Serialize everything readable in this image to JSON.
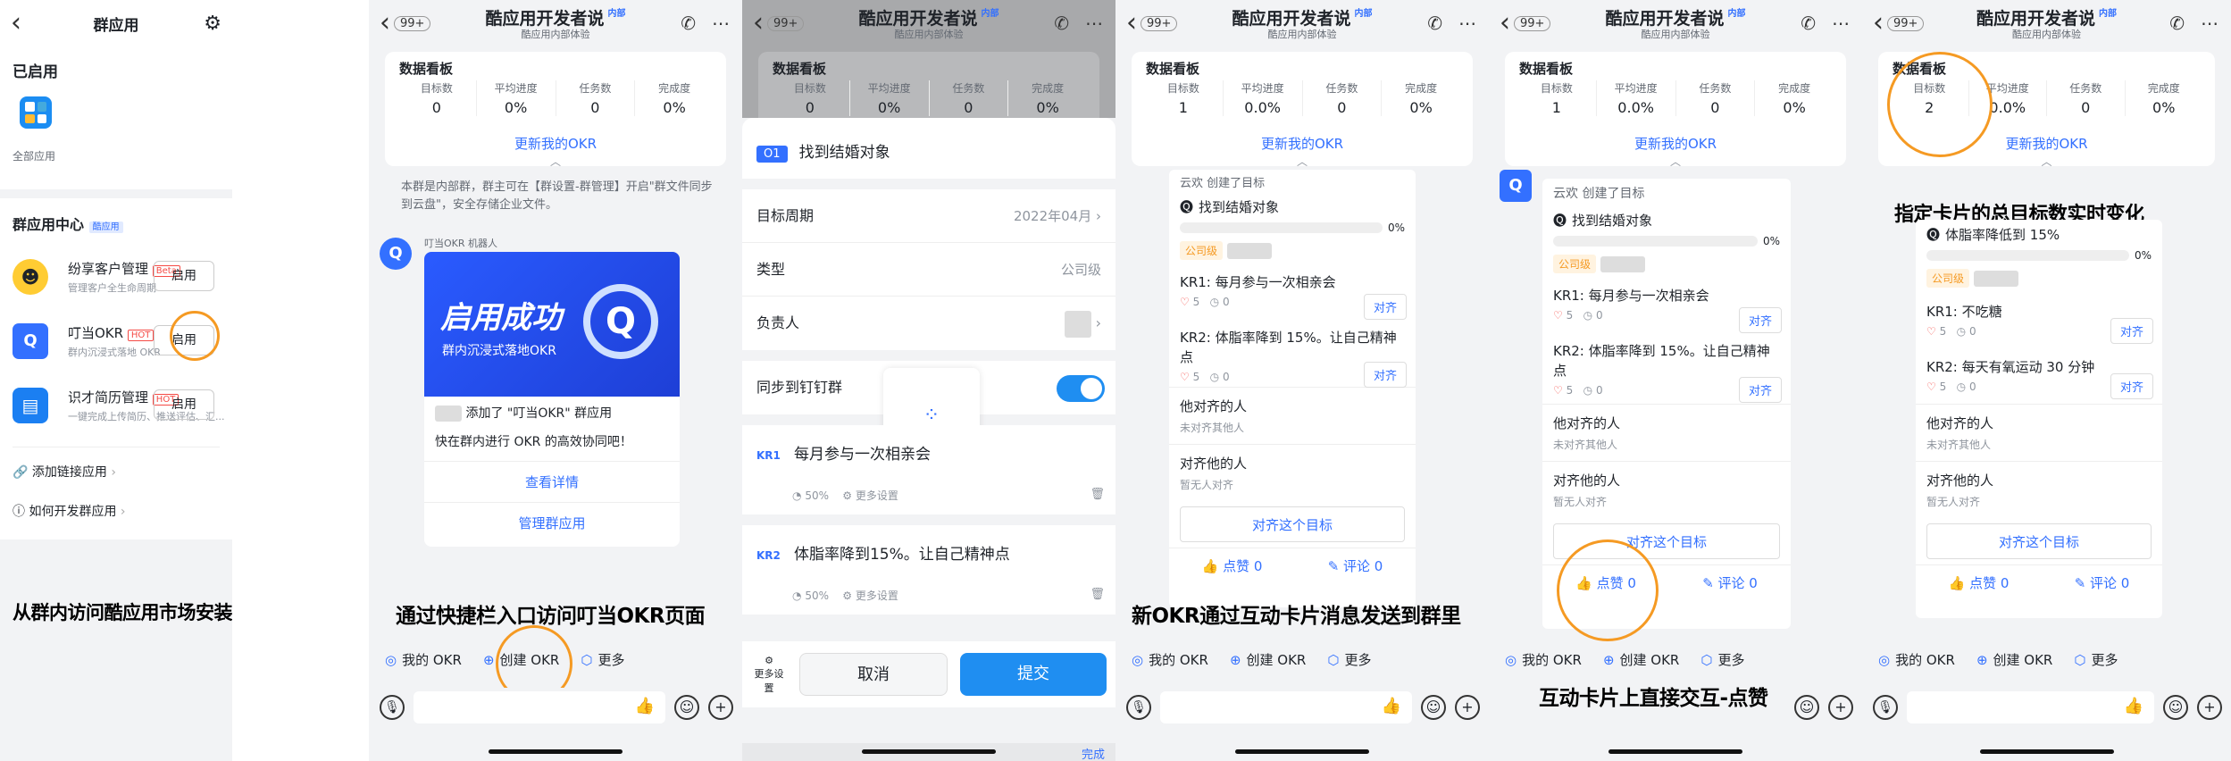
{
  "panel1": {
    "title": "群应用",
    "enabled_label": "已启用",
    "all_apps": "全部应用",
    "center_title": "群应用中心",
    "center_badge": "酷应用",
    "apps": [
      {
        "name": "纷享客户管理",
        "badge": "Beta",
        "desc": "管理客户全生命周期",
        "button": "启用"
      },
      {
        "name": "叮当OKR",
        "badge": "HOT",
        "desc": "群内沉浸式落地 OKR",
        "button": "启用"
      },
      {
        "name": "识才简历管理",
        "badge": "HOT",
        "desc": "一键完成上传简历、推送评估、汇...",
        "button": "启用"
      }
    ],
    "link1": "添加链接应用",
    "link2": "如何开发群应用",
    "caption": "从群内访问酷应用市场安装叮当OKR"
  },
  "common": {
    "badge": "99+",
    "title": "酷应用开发者说",
    "inner": "内部",
    "subtitle": "酷应用内部体验",
    "board_title": "数据看板",
    "col1": "目标数",
    "col2": "平均进度",
    "col3": "任务数",
    "col4": "完成度",
    "update": "更新我的OKR",
    "q1": "我的 OKR",
    "q2": "创建 OKR",
    "q3": "更多",
    "he_align": "他对齐的人",
    "he_align_sub": "未对齐其他人",
    "align_he": "对齐他的人",
    "align_he_sub": "暂无人对齐",
    "align_btn": "对齐这个目标",
    "like": "点赞 0",
    "comment": "评论 0",
    "align": "对齐"
  },
  "panel2": {
    "values": [
      "0",
      "0%",
      "0",
      "0%"
    ],
    "notice": "本群是内部群，群主可在【群设置-群管理】开启\"群文件同步到云盘\"，安全存储企业文件。",
    "bot": "叮当OKR",
    "bot_tag": "机器人",
    "banner_big": "启用成功",
    "banner_small": "群内沉浸式落地OKR",
    "added": "添加了 \"叮当OKR\" 群应用",
    "hint": "快在群内进行 OKR 的高效协同吧！",
    "details": "查看详情",
    "manage": "管理群应用",
    "caption": "通过快捷栏入口访问叮当OKR页面"
  },
  "panel3": {
    "values": [
      "0",
      "0%",
      "0",
      "0%"
    ],
    "o_tag": "O1",
    "objective": "找到结婚对象",
    "period_label": "目标周期",
    "period_value": "2022年04月",
    "type_label": "类型",
    "type_value": "公司级",
    "owner_label": "负责人",
    "sync_label": "同步到钉钉群",
    "kr1": "每月参与一次相亲会",
    "kr2": "体脂率降到15%。让自己精神点",
    "pct": "50%",
    "more": "更多设置",
    "more_settings": "更多设置",
    "cancel": "取消",
    "submit": "提交",
    "finish": "完成"
  },
  "panel4": {
    "values": [
      "1",
      "0.0%",
      "0",
      "0%"
    ],
    "created": "云欢 创建了目标",
    "objective": "找到结婚对象",
    "obj_pct": "0%",
    "level": "公司级",
    "kr1": "KR1:  每月参与一次相亲会",
    "kr2": "KR2:  体脂率降到 15%。让自己精神点",
    "caption": "新OKR通过互动卡片消息发送到群里"
  },
  "panel5": {
    "values": [
      "1",
      "0.0%",
      "0",
      "0%"
    ],
    "created": "云欢 创建了目标",
    "caption": "互动卡片上直接交互-点赞"
  },
  "panel6": {
    "values": [
      "2",
      "0.0%",
      "0",
      "0%"
    ],
    "objective": "体脂率降低到 15%",
    "kr1": "KR1:  不吃糖",
    "kr2": "KR2:  每天有氧运动 30 分钟",
    "caption": "指定卡片的总目标数实时变化"
  }
}
